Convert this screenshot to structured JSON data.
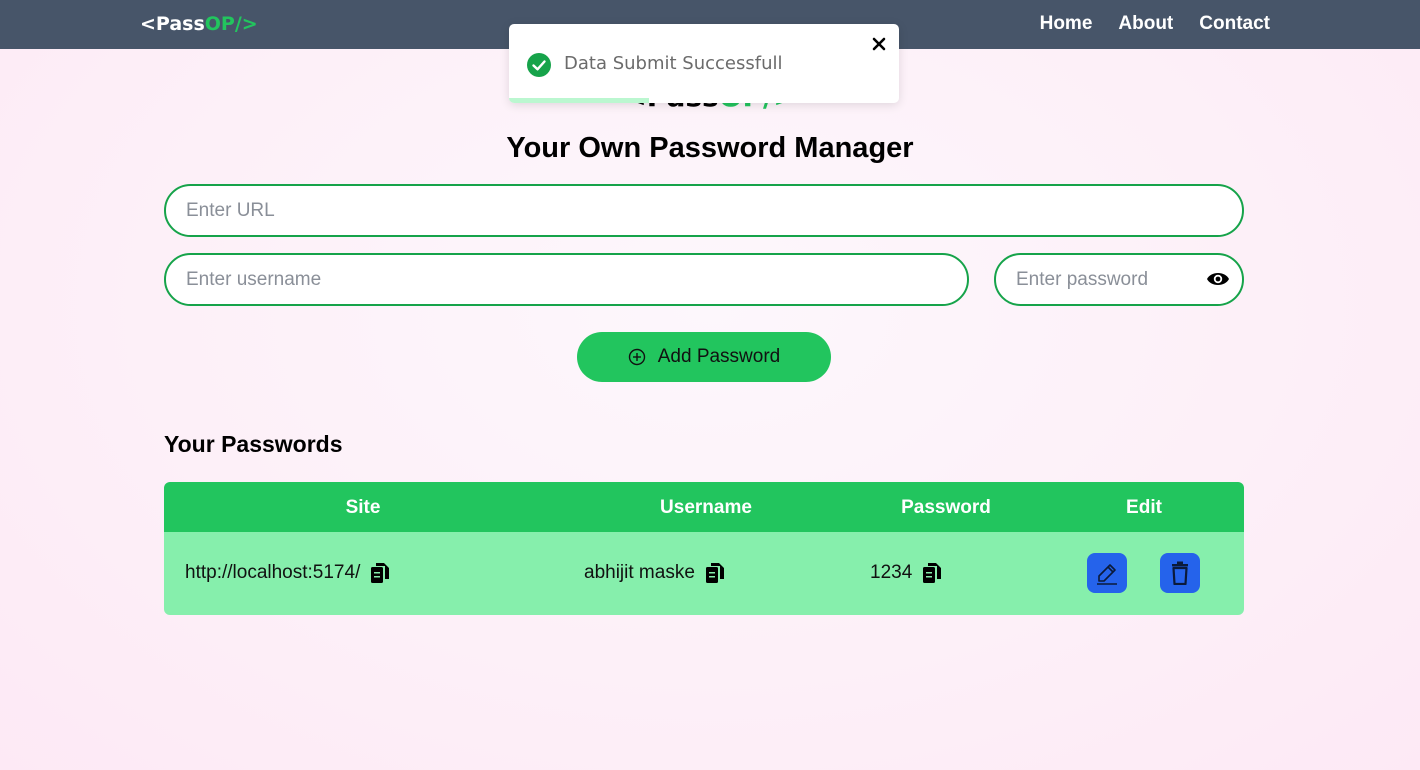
{
  "nav": {
    "logo_left": "<Pass",
    "logo_green": "OP/>",
    "links": [
      "Home",
      "About",
      "Contact"
    ]
  },
  "hero": {
    "logo_left": "<Pass",
    "logo_green": "OP/>",
    "title": "Your Own Password Manager"
  },
  "form": {
    "url_placeholder": "Enter URL",
    "username_placeholder": "Enter username",
    "password_placeholder": "Enter password",
    "add_label": "Add Password"
  },
  "passwords": {
    "title": "Your Passwords",
    "headers": [
      "Site",
      "Username",
      "Password",
      "Edit"
    ],
    "rows": [
      {
        "site": "http://localhost:5174/",
        "username": "abhijit maske",
        "password": "1234"
      }
    ]
  },
  "toast": {
    "message": "Data Submit Successfull",
    "progress": 0.36
  },
  "colors": {
    "nav": "#475569",
    "accent": "#22c55e",
    "row": "#86efac",
    "action": "#2563eb"
  }
}
